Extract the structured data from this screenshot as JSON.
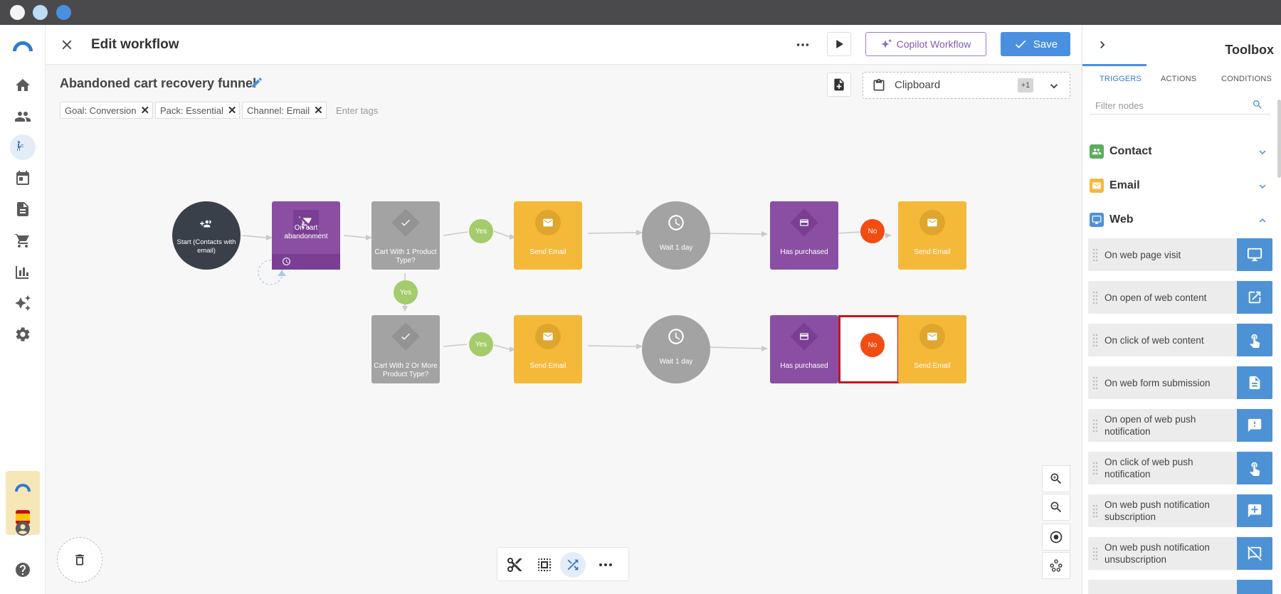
{
  "header": {
    "title": "Edit workflow",
    "copilot_label": "Copilot Workflow",
    "save_label": "Save"
  },
  "workflow": {
    "name": "Abandoned cart recovery funnel",
    "tags": [
      "Goal: Conversion",
      "Pack: Essential",
      "Channel: Email"
    ],
    "tags_placeholder": "Enter tags"
  },
  "clipboard": {
    "label": "Clipboard",
    "count": "+1"
  },
  "nodes": {
    "start": "Start (Contacts with email)",
    "trigger": "On cart abandonment",
    "cond1": "Cart With 1 Product Type?",
    "cond2": "Cart With 2 Or More Product Type?",
    "send_email": "Send Email",
    "wait": "Wait 1 day",
    "has_purchased": "Has purchased",
    "yes": "Yes",
    "no": "No"
  },
  "toolbox": {
    "title": "Toolbox",
    "tabs": [
      "TRIGGERS",
      "ACTIONS",
      "CONDITIONS"
    ],
    "filter_placeholder": "Filter nodes",
    "sections": [
      {
        "label": "Contact",
        "color": "#5cad5c"
      },
      {
        "label": "Email",
        "color": "#f5b93a"
      },
      {
        "label": "Web",
        "color": "#4e92d6"
      }
    ],
    "web_items": [
      {
        "label": "On web page visit",
        "icon": "monitor-icon"
      },
      {
        "label": "On open of web content",
        "icon": "open-external-icon"
      },
      {
        "label": "On click of web content",
        "icon": "pointer-hand-icon"
      },
      {
        "label": "On web form submission",
        "icon": "document-icon"
      },
      {
        "label": "On open of web push notification",
        "icon": "message-alert-icon"
      },
      {
        "label": "On click of web push notification",
        "icon": "pointer-hand-icon"
      },
      {
        "label": "On web push notification subscription",
        "icon": "message-plus-icon"
      },
      {
        "label": "On web push notification unsubscription",
        "icon": "message-off-icon"
      }
    ]
  },
  "colors": {
    "accent": "#3b78c4",
    "purple": "#8a4fa3",
    "gray_node": "#a3a3a3",
    "yellow_node": "#f5b93a",
    "yes_green": "#a4cc6c",
    "no_red": "#f24c12",
    "highlight_border": "#c4161c"
  }
}
